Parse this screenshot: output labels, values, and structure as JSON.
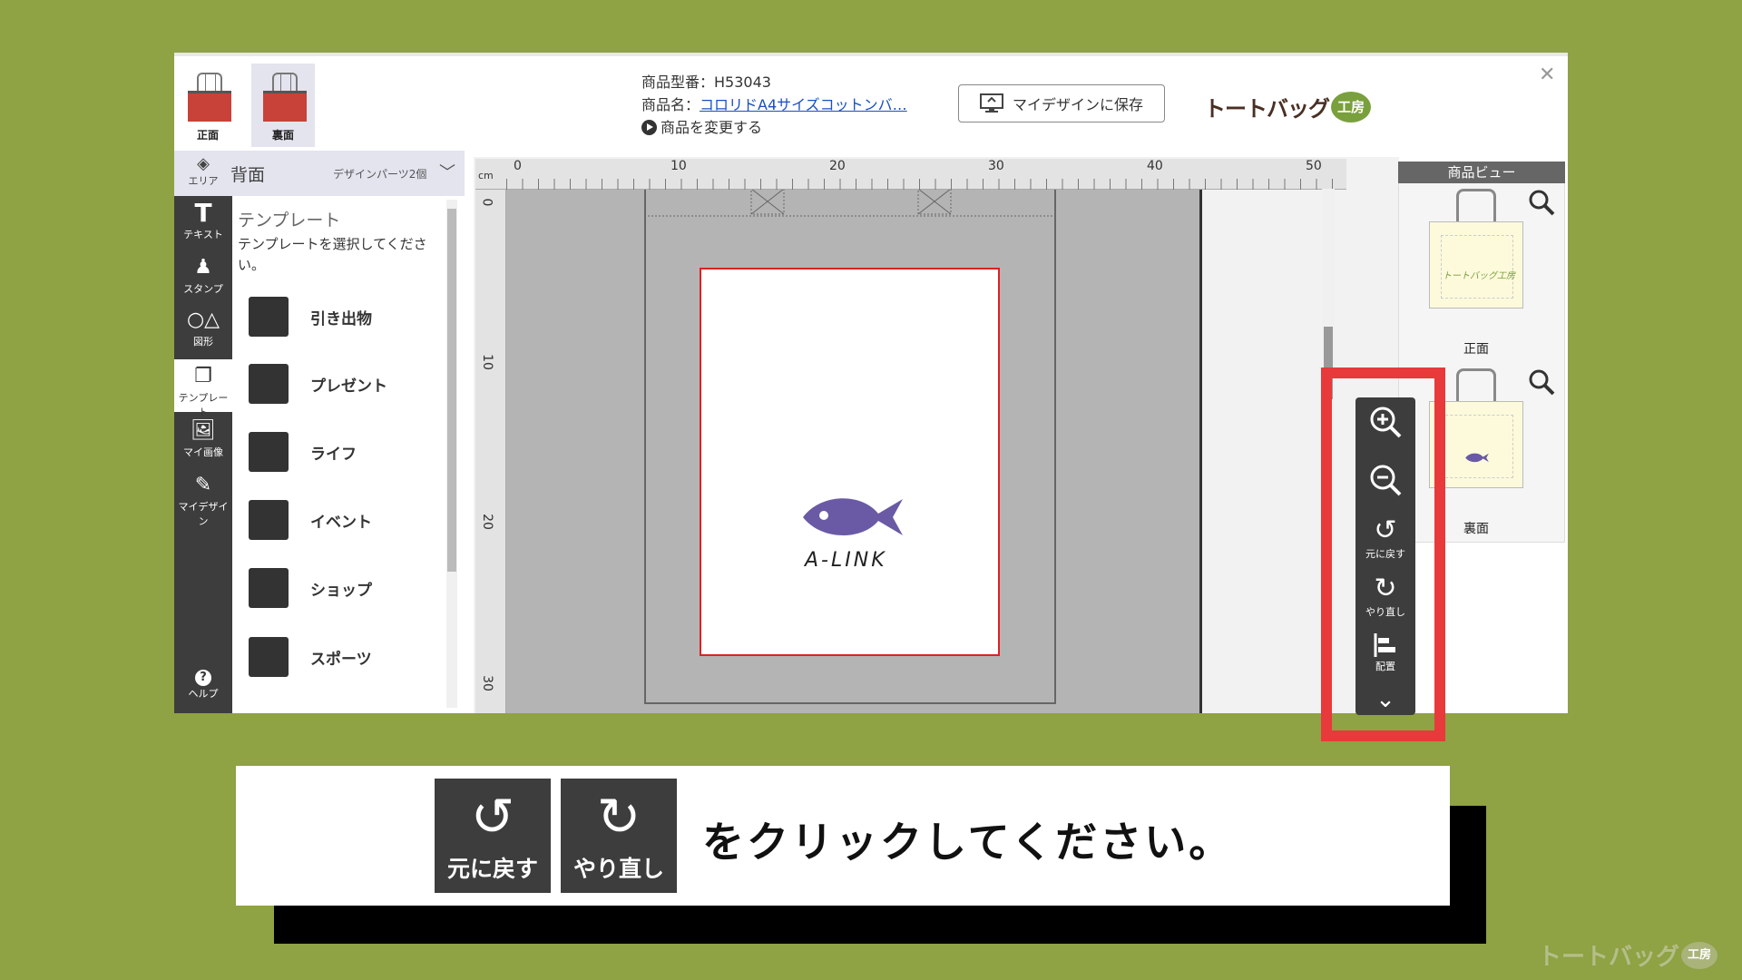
{
  "header": {
    "front_label": "正面",
    "back_label": "裏面",
    "product_code": "商品型番：H53043",
    "product_name_label": "商品名：",
    "product_name_link": "コロリドA4サイズコットンバ…",
    "change_product": "商品を変更する",
    "save_button": "マイデザインに保存",
    "logo_text": "トートバッグ",
    "logo_badge": "工房"
  },
  "left_panel": {
    "area_label": "エリア",
    "area_value": "背面",
    "design_parts": "デザインパーツ2個",
    "tools": [
      {
        "label": "テキスト"
      },
      {
        "label": "スタンプ"
      },
      {
        "label": "図形"
      },
      {
        "label": "テンプレート"
      },
      {
        "label": "マイ画像"
      },
      {
        "label": "マイデザイン"
      }
    ],
    "help_label": "ヘルプ"
  },
  "templates": {
    "title": "テンプレート",
    "description": "テンプレートを選択してください。",
    "items": [
      "引き出物",
      "プレゼント",
      "ライフ",
      "イベント",
      "ショップ",
      "スポーツ"
    ]
  },
  "canvas": {
    "unit": "cm",
    "top_ticks": [
      "0",
      "10",
      "20",
      "30",
      "40",
      "50"
    ],
    "left_ticks": [
      "0",
      "10",
      "20",
      "30"
    ],
    "design_text": "A-LINK",
    "fish_color": "#6a5aa5"
  },
  "product_view": {
    "title": "商品ビュー",
    "front": "正面",
    "back": "裏面"
  },
  "toolbar": {
    "undo": "元に戻す",
    "redo": "やり直し",
    "align": "配置"
  },
  "caption": {
    "undo": "元に戻す",
    "redo": "やり直し",
    "text": "をクリックしてください。"
  },
  "watermark": {
    "text": "トートバッグ",
    "badge": "工房"
  },
  "colors": {
    "background": "#8fa244",
    "highlight": "#e8393b",
    "panel_dark": "#3d3d3d"
  }
}
